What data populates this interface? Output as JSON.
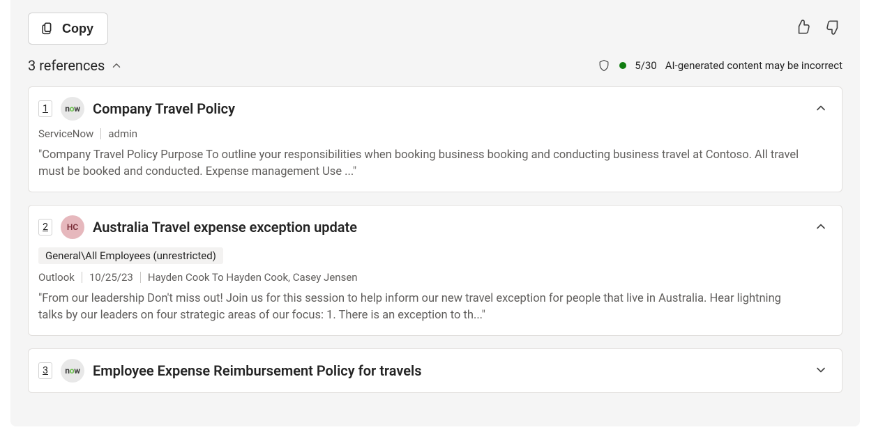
{
  "toolbar": {
    "copy_label": "Copy"
  },
  "references_header": {
    "label": "3 references"
  },
  "status": {
    "count": "5/30",
    "disclaimer": "AI-generated content may be incorrect"
  },
  "references": [
    {
      "index": "1",
      "source_icon": "servicenow",
      "title": "Company Travel Policy",
      "meta_source": "ServiceNow",
      "meta_author": "admin",
      "excerpt": "\"Company Travel Policy Purpose To outline your responsibilities when booking business booking and conducting business travel at Contoso. All travel must be booked and conducted. Expense management Use ...\"",
      "expanded": true
    },
    {
      "index": "2",
      "source_icon": "hc",
      "title": "Australia Travel expense exception update",
      "chip": "General\\All Employees (unrestricted)",
      "meta_source": "Outlook",
      "meta_date": "10/25/23",
      "meta_people": "Hayden Cook To Hayden Cook, Casey Jensen",
      "excerpt": "\"From our leadership Don't miss out! Join us for this session to help inform our new travel exception for people that live in Australia. Hear lightning talks by our leaders on four strategic areas of our focus: 1. There is an exception to th...\"",
      "expanded": true
    },
    {
      "index": "3",
      "source_icon": "servicenow",
      "title": "Employee Expense Reimbursement Policy for travels",
      "expanded": false
    }
  ]
}
